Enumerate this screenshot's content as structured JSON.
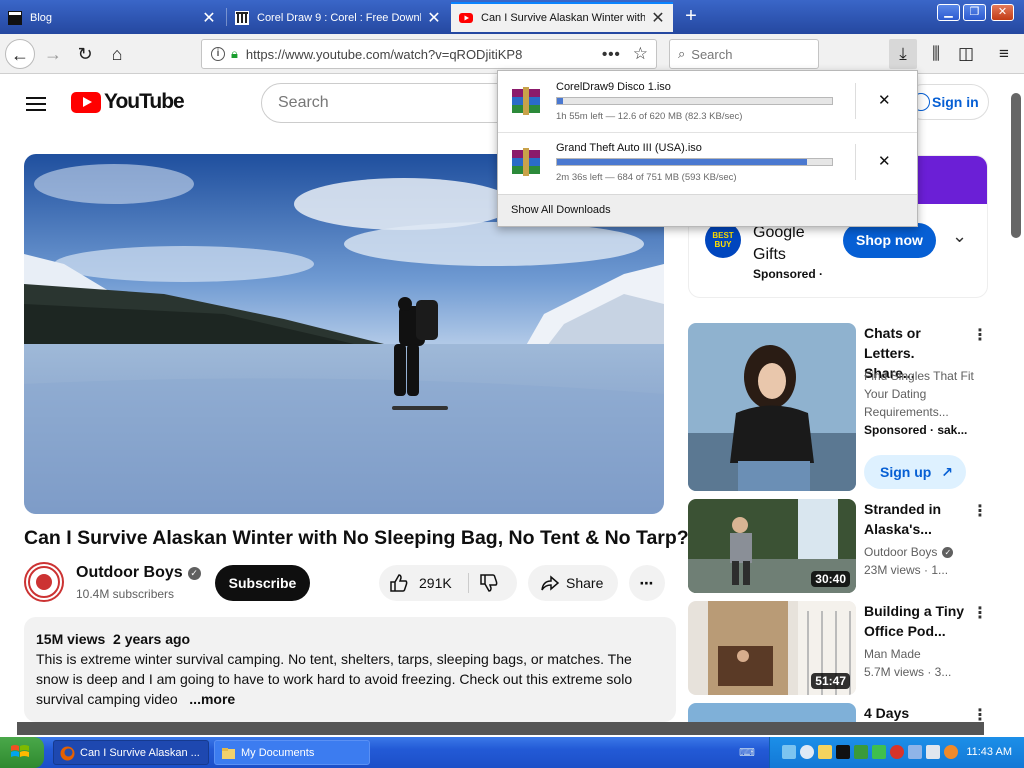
{
  "browser": {
    "tabs": [
      {
        "title": "Blog",
        "active": false
      },
      {
        "title": "Corel Draw 9 : Corel : Free Downl",
        "active": false
      },
      {
        "title": "Can I Survive Alaskan Winter with",
        "active": true
      }
    ],
    "url": "https://www.youtube.com/watch?v=qRODjitiKP8",
    "search_placeholder": "Search",
    "accent_color": "#0a84ff"
  },
  "downloads": {
    "items": [
      {
        "name": "CorelDraw9 Disco 1.iso",
        "status": "1h 55m left — 12.6 of 620 MB (82.3 KB/sec)",
        "progress": 0.02
      },
      {
        "name": "Grand Theft Auto III (USA).iso",
        "status": "2m 36s left — 684 of 751 MB (593 KB/sec)",
        "progress": 0.91
      }
    ],
    "show_all": "Show All Downloads"
  },
  "youtube": {
    "logo_text": "YouTube",
    "search_placeholder": "Search",
    "sign_in": "Sign in",
    "video": {
      "title": "Can I Survive Alaskan Winter with No Sleeping Bag, No Tent & No Tarp?",
      "channel": "Outdoor Boys",
      "subscribers": "10.4M subscribers",
      "subscribe_label": "Subscribe",
      "likes": "291K",
      "share_label": "Share",
      "views": "15M views",
      "age": "2 years ago",
      "description": "This is extreme winter survival camping. No tent, shelters, tarps, sleeping bags, or matches. The snow is deep and I am going to have to work hard to avoid freezing. Check out this extreme solo survival camping video",
      "more_label": "...more"
    },
    "ad": {
      "brand_logo": "BEST BUY",
      "title": "Google Gifts",
      "sponsored": "Sponsored",
      "sponsored_suffix": "·",
      "cta": "Shop now"
    },
    "recommendations": [
      {
        "title": "Chats or Letters. Share...",
        "meta1": "Find Singles That Fit Your Dating Requirements...",
        "meta2": "Sponsored · sak...",
        "cta": "Sign up",
        "duration": ""
      },
      {
        "title": "Stranded in Alaska's...",
        "meta1": "Outdoor Boys",
        "meta2": "23M views · 1...",
        "duration": "30:40"
      },
      {
        "title": "Building a Tiny Office Pod...",
        "meta1": "Man Made",
        "meta2": "5.7M views · 3...",
        "duration": "51:47"
      },
      {
        "title": "4 Days",
        "meta1": "",
        "meta2": "",
        "duration": ""
      }
    ],
    "brand_color": "#ff0000",
    "link_color": "#065fd4"
  },
  "taskbar": {
    "tasks": [
      {
        "label": "Can I Survive Alaskan ...",
        "active": true
      },
      {
        "label": "My Documents",
        "active": false
      }
    ],
    "clock": "11:43 AM"
  }
}
